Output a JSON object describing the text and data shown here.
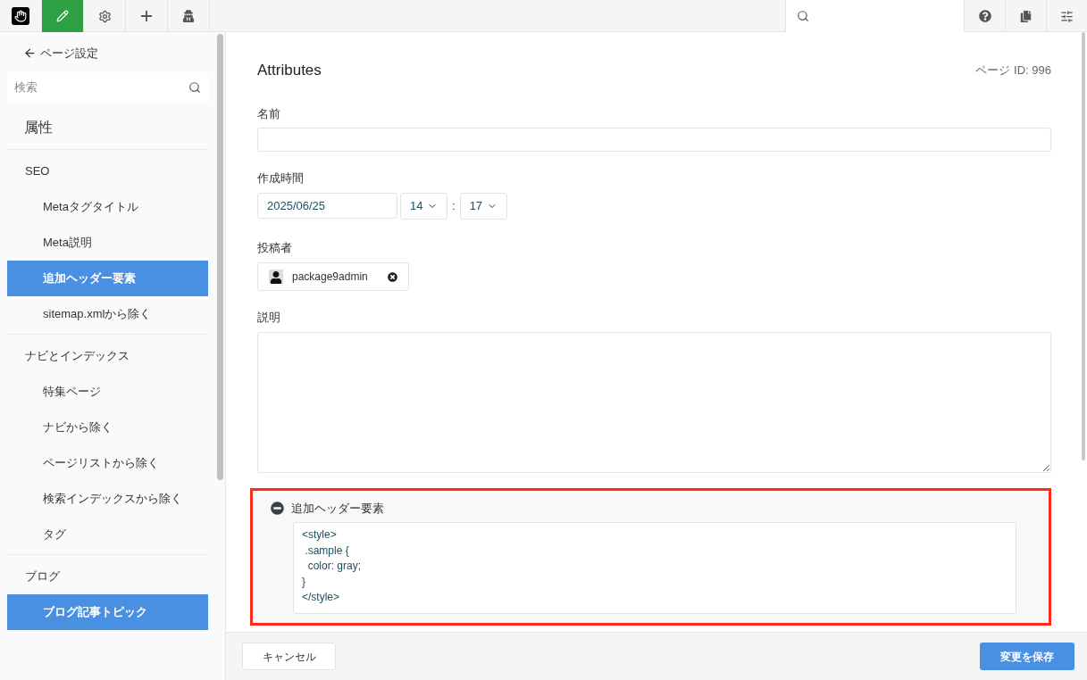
{
  "toolbar": {
    "left_buttons": [
      {
        "kind": "logo",
        "selected": false
      },
      {
        "kind": "pencil",
        "selected": true
      },
      {
        "kind": "gear",
        "selected": false
      },
      {
        "kind": "plus",
        "selected": false
      },
      {
        "kind": "agent",
        "selected": false
      }
    ],
    "right_buttons": [
      {
        "kind": "help"
      },
      {
        "kind": "pages"
      },
      {
        "kind": "sliders"
      }
    ]
  },
  "sidebar": {
    "back_link": "ページ設定",
    "search": {
      "placeholder": "検索"
    },
    "heading": "属性",
    "groups": [
      {
        "title": "SEO",
        "items": [
          {
            "label": "Metaタグタイトル",
            "selected": false
          },
          {
            "label": "Meta説明",
            "selected": false
          },
          {
            "label": "追加ヘッダー要素",
            "selected": true
          },
          {
            "label": "sitemap.xmlから除く",
            "selected": false
          }
        ]
      },
      {
        "title": "ナビとインデックス",
        "items": [
          {
            "label": "特集ページ",
            "selected": false
          },
          {
            "label": "ナビから除く",
            "selected": false
          },
          {
            "label": "ページリストから除く",
            "selected": false
          },
          {
            "label": "検索インデックスから除く",
            "selected": false
          },
          {
            "label": "タグ",
            "selected": false
          }
        ]
      },
      {
        "title": "ブログ",
        "items": [
          {
            "label": "ブログ記事トピック",
            "selected": true
          }
        ]
      }
    ]
  },
  "main": {
    "title": "Attributes",
    "page_id": "ページ ID: 996",
    "name": {
      "label": "名前"
    },
    "created": {
      "label": "作成時間",
      "date": "2025/06/25",
      "hour": "14",
      "separator": ":",
      "minute": "17"
    },
    "author": {
      "label": "投稿者",
      "user": "package9admin"
    },
    "description": {
      "label": "説明"
    },
    "header_element": {
      "label": "追加ヘッダー要素",
      "value": "<style>\n .sample {\n  color: gray;\n}\n</style>"
    }
  },
  "footer": {
    "cancel": "キャンセル",
    "save": "変更を保存"
  }
}
